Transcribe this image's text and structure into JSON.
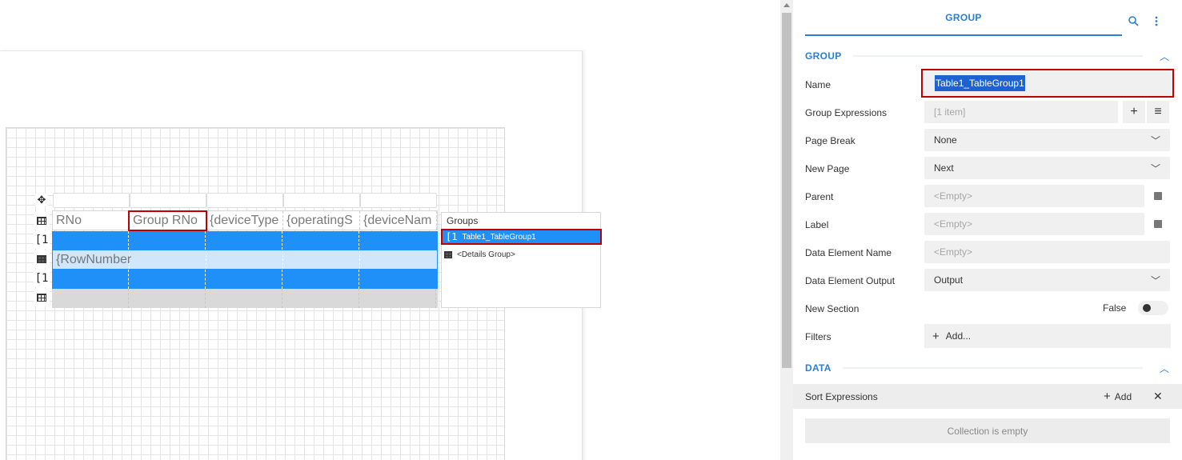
{
  "designer": {
    "header_cells": [
      "RNo",
      "Group RNo",
      "{deviceType",
      "{operatingS",
      "{deviceNam"
    ],
    "group1_row_glyph": "[1",
    "detail_row_first_cell": "{RowNumber",
    "group2_row_glyph": "[1",
    "move_icon": "move-icon",
    "groups_panel": {
      "title": "Groups",
      "items": [
        {
          "glyph": "[1",
          "label": "Table1_TableGroup1",
          "selected": true
        },
        {
          "glyph": "table-icon",
          "label": "<Details Group>",
          "selected": false
        }
      ]
    }
  },
  "panel": {
    "tab_label": "GROUP",
    "search_icon": "search-icon",
    "more_icon": "more-vertical-icon",
    "group_section": {
      "title": "GROUP",
      "properties": {
        "name_label": "Name",
        "name_value": "Table1_TableGroup1",
        "group_expressions_label": "Group Expressions",
        "group_expressions_value": "[1 item]",
        "page_break_label": "Page Break",
        "page_break_value": "None",
        "new_page_label": "New Page",
        "new_page_value": "Next",
        "parent_label": "Parent",
        "parent_value": "<Empty>",
        "label_label": "Label",
        "label_value": "<Empty>",
        "data_element_name_label": "Data Element Name",
        "data_element_name_value": "<Empty>",
        "data_element_output_label": "Data Element Output",
        "data_element_output_value": "Output",
        "new_section_label": "New Section",
        "new_section_value": "False",
        "filters_label": "Filters",
        "filters_add": "Add..."
      }
    },
    "data_section": {
      "title": "DATA",
      "sort_expressions_label": "Sort Expressions",
      "sort_add_label": "Add",
      "empty_text": "Collection is empty"
    }
  },
  "colors": {
    "accent": "#2a7fd4",
    "selection_blue": "#1e90f8",
    "highlight_red": "#c00000"
  }
}
